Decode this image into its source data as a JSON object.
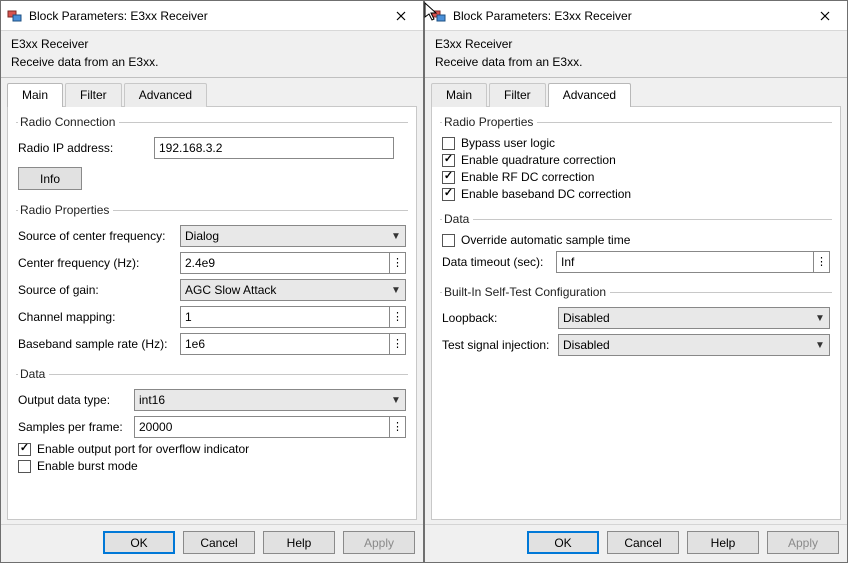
{
  "dialogA": {
    "title": "Block Parameters: E3xx Receiver",
    "block_name": "E3xx Receiver",
    "description": "Receive data from an E3xx.",
    "tabs": {
      "main": "Main",
      "filter": "Filter",
      "advanced": "Advanced",
      "active": "main"
    },
    "radio_connection": {
      "legend": "Radio Connection",
      "ip_label": "Radio IP address:",
      "ip_value": "192.168.3.2",
      "info_label": "Info"
    },
    "radio_properties": {
      "legend": "Radio Properties",
      "src_cf_label": "Source of center frequency:",
      "src_cf_value": "Dialog",
      "cf_label": "Center frequency (Hz):",
      "cf_value": "2.4e9",
      "src_gain_label": "Source of gain:",
      "src_gain_value": "AGC Slow Attack",
      "chmap_label": "Channel mapping:",
      "chmap_value": "1",
      "bbsr_label": "Baseband sample rate (Hz):",
      "bbsr_value": "1e6"
    },
    "data": {
      "legend": "Data",
      "out_dtype_label": "Output data type:",
      "out_dtype_value": "int16",
      "spf_label": "Samples per frame:",
      "spf_value": "20000",
      "overflow_label": "Enable output port for overflow indicator",
      "overflow_checked": true,
      "burst_label": "Enable burst mode",
      "burst_checked": false
    },
    "buttons": {
      "ok": "OK",
      "cancel": "Cancel",
      "help": "Help",
      "apply": "Apply"
    }
  },
  "dialogB": {
    "title": "Block Parameters: E3xx Receiver",
    "block_name": "E3xx Receiver",
    "description": "Receive data from an E3xx.",
    "tabs": {
      "main": "Main",
      "filter": "Filter",
      "advanced": "Advanced",
      "active": "advanced"
    },
    "radio_properties": {
      "legend": "Radio Properties",
      "bypass_label": "Bypass user logic",
      "bypass_checked": false,
      "quad_label": "Enable quadrature correction",
      "quad_checked": true,
      "rfdc_label": "Enable RF DC correction",
      "rfdc_checked": true,
      "bbdc_label": "Enable baseband DC correction",
      "bbdc_checked": true
    },
    "data": {
      "legend": "Data",
      "override_label": "Override automatic sample time",
      "override_checked": false,
      "timeout_label": "Data timeout (sec):",
      "timeout_value": "Inf"
    },
    "bist": {
      "legend": "Built-In Self-Test Configuration",
      "loopback_label": "Loopback:",
      "loopback_value": "Disabled",
      "inj_label": "Test signal injection:",
      "inj_value": "Disabled"
    },
    "buttons": {
      "ok": "OK",
      "cancel": "Cancel",
      "help": "Help",
      "apply": "Apply"
    }
  }
}
